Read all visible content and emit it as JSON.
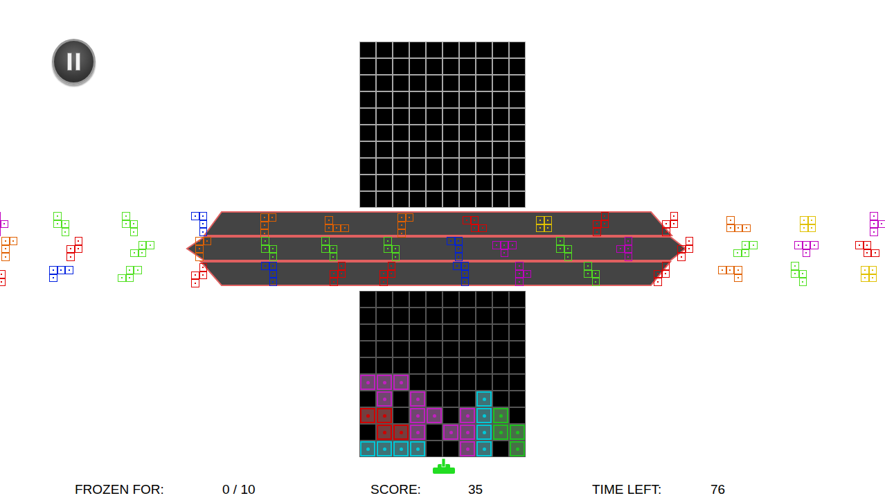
{
  "hud": [
    {
      "label": "FROZEN FOR:",
      "value": "0 / 10"
    },
    {
      "label": "SCORE:",
      "value": "35"
    },
    {
      "label": "TIME LEFT:",
      "value": "76"
    }
  ],
  "upper_board": {
    "rows": [
      [
        null,
        null,
        null,
        null,
        null,
        null,
        null,
        null,
        null,
        null
      ],
      [
        null,
        null,
        null,
        null,
        null,
        null,
        null,
        null,
        null,
        null
      ],
      [
        null,
        null,
        null,
        null,
        null,
        null,
        null,
        null,
        null,
        null
      ],
      [
        null,
        null,
        null,
        null,
        null,
        null,
        null,
        null,
        null,
        null
      ],
      [
        null,
        null,
        null,
        null,
        null,
        null,
        null,
        null,
        null,
        null
      ],
      [
        null,
        null,
        null,
        null,
        null,
        null,
        null,
        null,
        null,
        null
      ],
      [
        null,
        null,
        null,
        null,
        null,
        null,
        null,
        null,
        null,
        null
      ],
      [
        null,
        null,
        null,
        null,
        null,
        null,
        null,
        null,
        null,
        null
      ],
      [
        null,
        null,
        null,
        null,
        null,
        null,
        null,
        null,
        null,
        null
      ],
      [
        null,
        null,
        null,
        null,
        null,
        null,
        null,
        null,
        null,
        null
      ]
    ]
  },
  "lower_board": {
    "rows": [
      [
        null,
        null,
        null,
        null,
        null,
        null,
        null,
        null,
        null,
        null
      ],
      [
        null,
        null,
        null,
        null,
        null,
        null,
        null,
        null,
        null,
        null
      ],
      [
        null,
        null,
        null,
        null,
        null,
        null,
        null,
        null,
        null,
        null
      ],
      [
        null,
        null,
        null,
        null,
        null,
        null,
        null,
        null,
        null,
        null
      ],
      [
        null,
        null,
        null,
        null,
        null,
        null,
        null,
        null,
        null,
        null
      ],
      [
        "#c020c0",
        "#c020c0",
        "#c020c0",
        null,
        null,
        null,
        null,
        null,
        null,
        null
      ],
      [
        null,
        "#c020c0",
        null,
        "#c020c0",
        null,
        null,
        null,
        "#00c8d8",
        null,
        null
      ],
      [
        "#d00000",
        "#d00000",
        null,
        "#c020c0",
        "#c020c0",
        null,
        "#c020c0",
        "#00c8d8",
        "#20c020",
        null
      ],
      [
        null,
        "#d00000",
        "#d00000",
        "#c020c0",
        null,
        "#c020c0",
        "#c020c0",
        "#00c8d8",
        "#20c020",
        "#20c020"
      ],
      [
        "#00c8d8",
        "#00c8d8",
        "#00c8d8",
        "#00c8d8",
        null,
        null,
        "#c020c0",
        "#00c8d8",
        null,
        "#20c020"
      ]
    ]
  },
  "conveyor": {
    "lanes": [
      {
        "pieces": [
          {
            "color": "#c000c0",
            "cells": [
              [
                0,
                0
              ],
              [
                0,
                1
              ],
              [
                1,
                1
              ],
              [
                0,
                2
              ]
            ]
          },
          {
            "color": "#50e020",
            "cells": [
              [
                0,
                0
              ],
              [
                0,
                1
              ],
              [
                1,
                1
              ],
              [
                1,
                2
              ]
            ]
          },
          {
            "color": "#50e020",
            "cells": [
              [
                0,
                0
              ],
              [
                0,
                1
              ],
              [
                1,
                1
              ],
              [
                1,
                2
              ]
            ]
          },
          {
            "color": "#0020e0",
            "cells": [
              [
                0,
                0
              ],
              [
                1,
                0
              ],
              [
                1,
                1
              ],
              [
                1,
                2
              ]
            ]
          },
          {
            "color": "#e06000",
            "cells": [
              [
                0,
                0
              ],
              [
                1,
                0
              ],
              [
                0,
                1
              ],
              [
                0,
                2
              ]
            ]
          },
          {
            "color": "#e06000",
            "cells": [
              [
                0,
                0
              ],
              [
                0,
                1
              ],
              [
                1,
                1
              ],
              [
                2,
                1
              ]
            ]
          },
          {
            "color": "#e06000",
            "cells": [
              [
                0,
                0
              ],
              [
                1,
                0
              ],
              [
                0,
                1
              ],
              [
                0,
                2
              ]
            ]
          },
          {
            "color": "#e00000",
            "cells": [
              [
                0,
                0
              ],
              [
                1,
                0
              ],
              [
                1,
                1
              ],
              [
                2,
                1
              ]
            ]
          },
          {
            "color": "#e0c000",
            "cells": [
              [
                0,
                0
              ],
              [
                1,
                0
              ],
              [
                0,
                1
              ],
              [
                1,
                1
              ]
            ]
          },
          {
            "color": "#e00000",
            "cells": [
              [
                1,
                0
              ],
              [
                0,
                1
              ],
              [
                1,
                1
              ],
              [
                0,
                2
              ]
            ]
          },
          {
            "color": "#e00000",
            "cells": [
              [
                1,
                0
              ],
              [
                0,
                1
              ],
              [
                1,
                1
              ],
              [
                0,
                2
              ]
            ]
          },
          {
            "color": "#e06000",
            "cells": [
              [
                0,
                0
              ],
              [
                0,
                1
              ],
              [
                1,
                1
              ],
              [
                2,
                1
              ]
            ]
          },
          {
            "color": "#e0c000",
            "cells": [
              [
                0,
                0
              ],
              [
                1,
                0
              ],
              [
                0,
                1
              ],
              [
                1,
                1
              ]
            ]
          },
          {
            "color": "#c000c0",
            "cells": [
              [
                0,
                0
              ],
              [
                0,
                1
              ],
              [
                1,
                1
              ],
              [
                0,
                2
              ]
            ]
          }
        ]
      },
      {
        "pieces": [
          {
            "color": "#e06000",
            "cells": [
              [
                0,
                0
              ],
              [
                1,
                0
              ],
              [
                0,
                1
              ],
              [
                0,
                2
              ]
            ]
          },
          {
            "color": "#e00000",
            "cells": [
              [
                1,
                0
              ],
              [
                0,
                1
              ],
              [
                1,
                1
              ],
              [
                0,
                2
              ]
            ]
          },
          {
            "color": "#50e020",
            "cells": [
              [
                1,
                0
              ],
              [
                2,
                0
              ],
              [
                0,
                1
              ],
              [
                1,
                1
              ]
            ]
          },
          {
            "color": "#e06000",
            "cells": [
              [
                0,
                0
              ],
              [
                1,
                0
              ],
              [
                0,
                1
              ],
              [
                0,
                2
              ]
            ]
          },
          {
            "color": "#50e020",
            "cells": [
              [
                0,
                0
              ],
              [
                0,
                1
              ],
              [
                1,
                1
              ],
              [
                1,
                2
              ]
            ]
          },
          {
            "color": "#50e020",
            "cells": [
              [
                0,
                0
              ],
              [
                0,
                1
              ],
              [
                1,
                1
              ],
              [
                1,
                2
              ]
            ]
          },
          {
            "color": "#50e020",
            "cells": [
              [
                0,
                0
              ],
              [
                0,
                1
              ],
              [
                1,
                1
              ],
              [
                1,
                2
              ]
            ]
          },
          {
            "color": "#0020e0",
            "cells": [
              [
                0,
                0
              ],
              [
                1,
                0
              ],
              [
                1,
                1
              ],
              [
                1,
                2
              ]
            ]
          },
          {
            "color": "#c000c0",
            "cells": [
              [
                0,
                0
              ],
              [
                1,
                0
              ],
              [
                2,
                0
              ],
              [
                1,
                1
              ]
            ]
          },
          {
            "color": "#50e020",
            "cells": [
              [
                0,
                0
              ],
              [
                0,
                1
              ],
              [
                1,
                1
              ],
              [
                1,
                2
              ]
            ]
          },
          {
            "color": "#c000c0",
            "cells": [
              [
                1,
                0
              ],
              [
                0,
                1
              ],
              [
                1,
                1
              ],
              [
                1,
                2
              ]
            ]
          },
          {
            "color": "#e00000",
            "cells": [
              [
                1,
                0
              ],
              [
                0,
                1
              ],
              [
                1,
                1
              ],
              [
                0,
                2
              ]
            ]
          },
          {
            "color": "#50e020",
            "cells": [
              [
                1,
                0
              ],
              [
                2,
                0
              ],
              [
                0,
                1
              ],
              [
                1,
                1
              ]
            ]
          },
          {
            "color": "#c000c0",
            "cells": [
              [
                0,
                0
              ],
              [
                1,
                0
              ],
              [
                2,
                0
              ],
              [
                1,
                1
              ]
            ]
          },
          {
            "color": "#e00000",
            "cells": [
              [
                0,
                0
              ],
              [
                1,
                0
              ],
              [
                1,
                1
              ],
              [
                2,
                1
              ]
            ]
          }
        ]
      },
      {
        "pieces": [
          {
            "color": "#e00000",
            "cells": [
              [
                0,
                0
              ],
              [
                0,
                1
              ]
            ]
          },
          {
            "color": "#0020e0",
            "cells": [
              [
                0,
                0
              ],
              [
                1,
                0
              ],
              [
                2,
                0
              ],
              [
                0,
                1
              ]
            ]
          },
          {
            "color": "#50e020",
            "cells": [
              [
                1,
                0
              ],
              [
                2,
                0
              ],
              [
                0,
                1
              ],
              [
                1,
                1
              ]
            ]
          },
          {
            "color": "#e00000",
            "cells": [
              [
                1,
                0
              ],
              [
                0,
                1
              ],
              [
                1,
                1
              ],
              [
                0,
                2
              ]
            ]
          },
          {
            "color": "#0020e0",
            "cells": [
              [
                0,
                0
              ],
              [
                1,
                0
              ],
              [
                1,
                1
              ],
              [
                1,
                2
              ]
            ]
          },
          {
            "color": "#e00000",
            "cells": [
              [
                1,
                0
              ],
              [
                0,
                1
              ],
              [
                1,
                1
              ],
              [
                0,
                2
              ]
            ]
          },
          {
            "color": "#e00000",
            "cells": [
              [
                1,
                0
              ],
              [
                0,
                1
              ],
              [
                1,
                1
              ],
              [
                0,
                2
              ]
            ]
          },
          {
            "color": "#0020e0",
            "cells": [
              [
                0,
                0
              ],
              [
                1,
                0
              ],
              [
                1,
                1
              ],
              [
                1,
                2
              ]
            ]
          },
          {
            "color": "#c000c0",
            "cells": [
              [
                0,
                0
              ],
              [
                0,
                1
              ],
              [
                1,
                1
              ],
              [
                0,
                2
              ]
            ]
          },
          {
            "color": "#50e020",
            "cells": [
              [
                0,
                0
              ],
              [
                0,
                1
              ],
              [
                1,
                1
              ],
              [
                1,
                2
              ]
            ]
          },
          {
            "color": "#e00000",
            "cells": [
              [
                1,
                0
              ],
              [
                0,
                1
              ],
              [
                1,
                1
              ],
              [
                0,
                2
              ]
            ]
          },
          {
            "color": "#e06000",
            "cells": [
              [
                0,
                0
              ],
              [
                1,
                0
              ],
              [
                2,
                0
              ],
              [
                2,
                1
              ]
            ]
          },
          {
            "color": "#50e020",
            "cells": [
              [
                0,
                0
              ],
              [
                0,
                1
              ],
              [
                1,
                1
              ],
              [
                1,
                2
              ]
            ]
          },
          {
            "color": "#e0c000",
            "cells": [
              [
                0,
                0
              ],
              [
                1,
                0
              ],
              [
                0,
                1
              ],
              [
                1,
                1
              ]
            ]
          }
        ]
      }
    ]
  }
}
